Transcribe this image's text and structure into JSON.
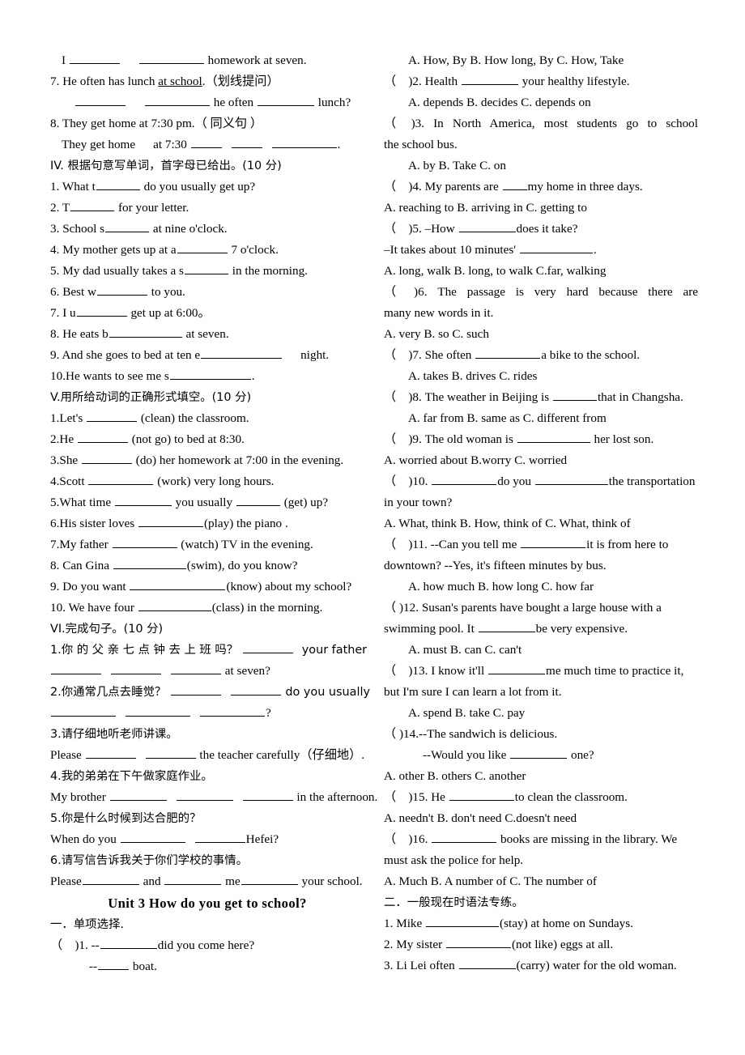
{
  "document": {
    "type": "english-exam-worksheet",
    "language": "en-zh",
    "columns": 2
  },
  "left_column": {
    "lines": [
      {
        "id": "l1",
        "text": "I ________  _________ homework at seven."
      },
      {
        "id": "l2",
        "text": "7. He often has lunch at school.（划线提问）",
        "underlined": "at school"
      },
      {
        "id": "l3",
        "text": "_______  _________ he often ________ lunch?"
      },
      {
        "id": "l4",
        "text": "8. They get home at 7:30 pm.（ 同义句 ）"
      },
      {
        "id": "l5",
        "text": "They get home   at 7:30 ____  ____  _________."
      },
      {
        "id": "l6",
        "text": "IV. 根据句意写单词，首字母已给出。(10 分)"
      },
      {
        "id": "l7",
        "text": "1. What t______ do you usually get up?"
      },
      {
        "id": "l8",
        "text": "2. T______ for your letter."
      },
      {
        "id": "l9",
        "text": "3. School s______ at nine o'clock."
      },
      {
        "id": "l10",
        "text": "4. My mother gets up at a_______ 7 o'clock."
      },
      {
        "id": "l11",
        "text": "5. My dad usually takes a s______ in the morning."
      },
      {
        "id": "l12",
        "text": "6. Best w_______ to you."
      },
      {
        "id": "l13",
        "text": "7. I u_______ get up at 6:00。"
      },
      {
        "id": "l14",
        "text": "8. He eats b__________ at seven."
      },
      {
        "id": "l15",
        "text": "9. And she goes to bed at ten e___________ night."
      },
      {
        "id": "l16",
        "text": "10.He wants to see me s___________."
      },
      {
        "id": "l17",
        "text": "V.用所给动词的正确形式填空。(10 分)"
      },
      {
        "id": "l18",
        "text": "1.Let's ______ (clean) the classroom."
      },
      {
        "id": "l19",
        "text": "2.He ______ (not go) to bed at 8:30."
      },
      {
        "id": "l20",
        "text": "3.She ______ (do) her homework at 7:00 in the evening."
      },
      {
        "id": "l21",
        "text": "4.Scott ________ (work) very long hours."
      },
      {
        "id": "l22",
        "text": "5.What time _______ you usually _____ (get) up?"
      },
      {
        "id": "l23",
        "text": "6.His sister loves ________(play) the piano ."
      },
      {
        "id": "l24",
        "text": "7.My father ________ (watch) TV in the evening."
      },
      {
        "id": "l25",
        "text": "8. Can Gina __________(swim), do you know?"
      },
      {
        "id": "l26",
        "text": "9. Do you want _____________(know) about my school?"
      },
      {
        "id": "l27",
        "text": "10. We have four __________(class) in the morning."
      },
      {
        "id": "l28",
        "text": "VI.完成句子。(10 分)"
      },
      {
        "id": "l29",
        "text": "1.你的父亲七点钟去上班吗？ ______ your father"
      },
      {
        "id": "l30",
        "text": "______ ______ ______ at seven?"
      },
      {
        "id": "l31",
        "text": "2.你通常几点去睡觉？ ______ ______ do you usually"
      },
      {
        "id": "l32",
        "text": "________ ________ ________?"
      },
      {
        "id": "l33",
        "text": "3.请仔细地听老师讲课。"
      },
      {
        "id": "l34",
        "text": "Please ______ ______ the teacher carefully（仔细地）."
      },
      {
        "id": "l35",
        "text": "4.我的弟弟在下午做家庭作业。"
      },
      {
        "id": "l36",
        "text": "My brother _______ ________ ______ in the afternoon."
      },
      {
        "id": "l37",
        "text": "5.你是什么时候到达合肥的？"
      },
      {
        "id": "l38",
        "text": "When do you ________ ______ Hefei?"
      },
      {
        "id": "l39",
        "text": "6.请写信告诉我关于你们学校的事情。"
      },
      {
        "id": "l40",
        "text": "Please________ and _______ me_______ your school."
      },
      {
        "id": "l41",
        "text": "Unit   3   How do you get to school?",
        "style": "unit-title"
      },
      {
        "id": "l42",
        "text": "一．单项选择."
      },
      {
        "id": "l43",
        "text": "（  )1. --_______did you come here?"
      },
      {
        "id": "l44",
        "text": "--____ boat."
      }
    ]
  },
  "right_column": {
    "lines": [
      {
        "id": "r1",
        "text": "A. How, By   B. How long, By    C. How, Take"
      },
      {
        "id": "r2",
        "text": "（  )2. Health ______ your healthy lifestyle."
      },
      {
        "id": "r3",
        "text": "A. depends    B. decides     C. depends       on"
      },
      {
        "id": "r4",
        "text": "（   )3. In North America, most students go to school"
      },
      {
        "id": "r5",
        "text": "the school bus."
      },
      {
        "id": "r6",
        "text": "A. by     B. Take        C. on"
      },
      {
        "id": "r7",
        "text": "（  )4. My parents are ___my home in three days."
      },
      {
        "id": "r8",
        "text": "A. reaching to    B. arriving in   C. getting to"
      },
      {
        "id": "r9",
        "text": "（  )5. –How _______does it take?"
      },
      {
        "id": "r10",
        "text": "–It takes about 10 minutes' _________."
      },
      {
        "id": "r11",
        "text": "A. long, walk B. long, to walk     C.far, walking"
      },
      {
        "id": "r12",
        "text": "（   )6. The passage is very hard because there are"
      },
      {
        "id": "r13",
        "text": "many new words in it."
      },
      {
        "id": "r14",
        "text": "A. very          B. so             C. such"
      },
      {
        "id": "r15",
        "text": "（  )7. She often ________a bike to the school."
      },
      {
        "id": "r16",
        "text": "A. takes      B. drives      C. rides"
      },
      {
        "id": "r17",
        "text": "（  )8. The weather in Beijing is _____that in Changsha."
      },
      {
        "id": "r18",
        "text": "A. far from    B. same as    C. different from"
      },
      {
        "id": "r19",
        "text": "（  )9. The old woman is __________ her lost son."
      },
      {
        "id": "r20",
        "text": "A. worried about        B.worry           C. worried"
      },
      {
        "id": "r21",
        "text": "（  )10. ________do you __________the transportation"
      },
      {
        "id": "r22",
        "text": "in your town?"
      },
      {
        "id": "r23",
        "text": "A. What, think    B. How, think of C. What, think of"
      },
      {
        "id": "r24",
        "text": "（  )11. --Can you tell me ________it is from here   to"
      },
      {
        "id": "r25",
        "text": "downtown?   --Yes, it's fifteen minutes by bus."
      },
      {
        "id": "r26",
        "text": "A. how much       B. how long   C. how far"
      },
      {
        "id": "r27",
        "text": "（  )12. Susan's parents have bought a large house with a"
      },
      {
        "id": "r28",
        "text": "swimming pool. It _______be very expensive."
      },
      {
        "id": "r29",
        "text": "A. must     B. can     C. can't"
      },
      {
        "id": "r30",
        "text": "（  )13. I know it'll _______me much time to practice it,"
      },
      {
        "id": "r31",
        "text": "but I'm sure I can learn a lot from it."
      },
      {
        "id": "r32",
        "text": "A. spend     B. take     C. pay"
      },
      {
        "id": "r33",
        "text": "（  )14.--The sandwich is delicious."
      },
      {
        "id": "r34",
        "text": "--Would you like _______ one?"
      },
      {
        "id": "r35",
        "text": "A. other               B. others            C. another"
      },
      {
        "id": "r36",
        "text": "（  )15. He ________to clean the classroom."
      },
      {
        "id": "r37",
        "text": "A. needn't    B. don't need  C.doesn't need"
      },
      {
        "id": "r38",
        "text": "（  )16. ________ books are missing in the library. We"
      },
      {
        "id": "r39",
        "text": "must ask the police for help."
      },
      {
        "id": "r40",
        "text": "A. Much        B. A number of      C. The number of"
      },
      {
        "id": "r41",
        "text": "二．一般现在时语法专练。"
      },
      {
        "id": "r42",
        "text": "1. Mike _________(stay) at home on Sundays."
      },
      {
        "id": "r43",
        "text": "2. My sister ________(not like) eggs at all."
      },
      {
        "id": "r44",
        "text": "3. Li Lei often _______(carry) water for the old woman."
      }
    ]
  },
  "text_fragments": {
    "l1_a": "I",
    "l1_b": "homework at seven.",
    "l2_a": "7. He often has lunch ",
    "l2_u": "at school",
    "l2_b": ".（划线提问）",
    "l3_a": "he often",
    "l3_b": "lunch?",
    "l4": "8. They get home at 7:30 pm.（ 同义句 ）",
    "l5_a": "They get home",
    "l5_b": "at 7:30",
    "l6": "IV. 根据句意写单词，首字母已给出。(10 分)",
    "l7_a": "1. What t",
    "l7_b": "do you usually get up?",
    "l8_a": "2. T",
    "l8_b": "for your letter.",
    "l9_a": "3. School s",
    "l9_b": "at nine o'clock.",
    "l10_a": "4. My mother gets up at a",
    "l10_b": "7 o'clock.",
    "l11_a": "5. My dad usually takes a s",
    "l11_b": "in the morning.",
    "l12_a": "6. Best w",
    "l12_b": "to you.",
    "l13_a": "7. I u",
    "l13_b": "get up at 6:00。",
    "l14_a": "8. He eats b",
    "l14_b": "at seven.",
    "l15_a": "9.  And  she  goes  to  bed  at  ten  e",
    "l15_b": "night.",
    "l16_a": "10.He wants to see me s",
    "l16_b": ".",
    "l17": "V.用所给动词的正确形式填空。(10 分)",
    "l18_a": "1.Let's",
    "l18_b": "(clean) the classroom.",
    "l19_a": "2.He",
    "l19_b": "(not go) to bed at 8:30.",
    "l20_a": "3.She",
    "l20_b": "(do) her homework at 7:00 in the evening.",
    "l21_a": "4.Scott",
    "l21_b": "(work) very long hours.",
    "l22_a": "5.What time",
    "l22_b": "you usually",
    "l22_c": "(get) up?",
    "l23_a": "6.His sister loves",
    "l23_b": "(play) the piano .",
    "l24_a": "7.My father",
    "l24_b": "(watch) TV in the evening.",
    "l25_a": "8. Can Gina",
    "l25_b": "(swim), do you know?",
    "l26_a": "9. Do you want",
    "l26_b": "(know) about my school?",
    "l27_a": "10. We have four",
    "l27_b": "(class) in the morning.",
    "l28": "VI.完成句子。(10 分)",
    "l29_a": "1.你 的 父 亲 七 点 钟 去 上 班 吗？",
    "l29_b": "your  father",
    "l30_b": "at seven?",
    "l31_a": "2.你通常几点去睡觉？",
    "l31_b": "do you usually",
    "l32_b": "?",
    "l33": "3.请仔细地听老师讲课。",
    "l34_a": "Please",
    "l34_b": "the teacher carefully（仔细地）.",
    "l35": "4.我的弟弟在下午做家庭作业。",
    "l36_a": "My brother",
    "l36_b": "in the afternoon.",
    "l37": "5.你是什么时候到达合肥的？",
    "l38_a": "When do you",
    "l38_b": "Hefei?",
    "l39": "6.请写信告诉我关于你们学校的事情。",
    "l40_a": "Please",
    "l40_b": "and",
    "l40_c": "me",
    "l40_d": "your school.",
    "l41": "Unit   3   How do you get to school?",
    "l42": "一．单项选择.",
    "l43_a": "（  )1. --",
    "l43_b": "did you come here?",
    "l44_a": "--",
    "l44_b": "boat.",
    "r1": "A. How, By    B. How long, By     C. How, Take",
    "r2_a": "（  )2. Health",
    "r2_b": "your healthy lifestyle.",
    "r3": "A. depends     B. decides       C. depends        on",
    "r4": "（   )3.  In  North  America,  most  students  go  to  school",
    "r5": "the school bus.",
    "r6": "A. by      B. Take         C. on",
    "r7_a": "（  )4. My parents are",
    "r7_b": "my home in three days.",
    "r8": "A. reaching to     B. arriving in   C. getting to",
    "r9_a": "（  )5. –How",
    "r9_b": "does it take?",
    "r10_a": "–It takes about 10 minutes'",
    "r10_b": ".",
    "r11": "A. long, walk B. long, to walk      C.far, walking",
    "r12": "（    )6.  The  passage  is  very  hard  because  there  are",
    "r13": "many new words in it.",
    "r14": "A. very           B. so                 C. such",
    "r15_a": "（  )7. She often",
    "r15_b": "a bike to the school.",
    "r16": "A. takes       B. drives       C. rides",
    "r17_a": "（  )8. The weather in Beijing is",
    "r17_b": "that in Changsha.",
    "r18": "A. far from     B. same as     C. different from",
    "r19_a": "（  )9. The old woman is",
    "r19_b": "her lost son.",
    "r20": "A. worried about           B.worry              C. worried",
    "r21_a": "（  )10.",
    "r21_b": "do you",
    "r21_c": "the transportation",
    "r22": "in your town?",
    "r23": "A. What, think    B. How, think of C. What, think of",
    "r24_a": "（  )11. --Can you tell me",
    "r24_b": "it is from here    to",
    "r25": "downtown?    --Yes, it's fifteen minutes by bus.",
    "r26": "A. how much        B. how long    C. how far",
    "r27": "（  )12. Susan's parents have bought a large house with a",
    "r28_a": "swimming pool. It",
    "r28_b": "be very expensive.",
    "r29": "A. must      B. can      C. can't",
    "r30_a": "（  )13. I know it'll",
    "r30_b": "me much time to practice it,",
    "r31": "but I'm sure I can learn a lot from it.",
    "r32": "A. spend      B. take      C. pay",
    "r33": "（  )14.--The sandwich is delicious.",
    "r34_a": "--Would you like",
    "r34_b": "one?",
    "r35": "A. other                B. others             C. another",
    "r36_a": "（  )15. He",
    "r36_b": "to clean the classroom.",
    "r37": "A. needn't     B. don't need  C.doesn't need",
    "r38_a": "（  )16.",
    "r38_b": "books are missing in the library. We",
    "r39": "must ask the police for help.",
    "r40": "A. Much         B. A number of       C. The number of",
    "r41": "二．一般现在时语法专练。",
    "r42_a": "1. Mike",
    "r42_b": "(stay) at home on Sundays.",
    "r43_a": "2. My sister",
    "r43_b": "(not like) eggs at all.",
    "r44_a": "3. Li Lei often",
    "r44_b": "(carry) water for the old woman."
  }
}
